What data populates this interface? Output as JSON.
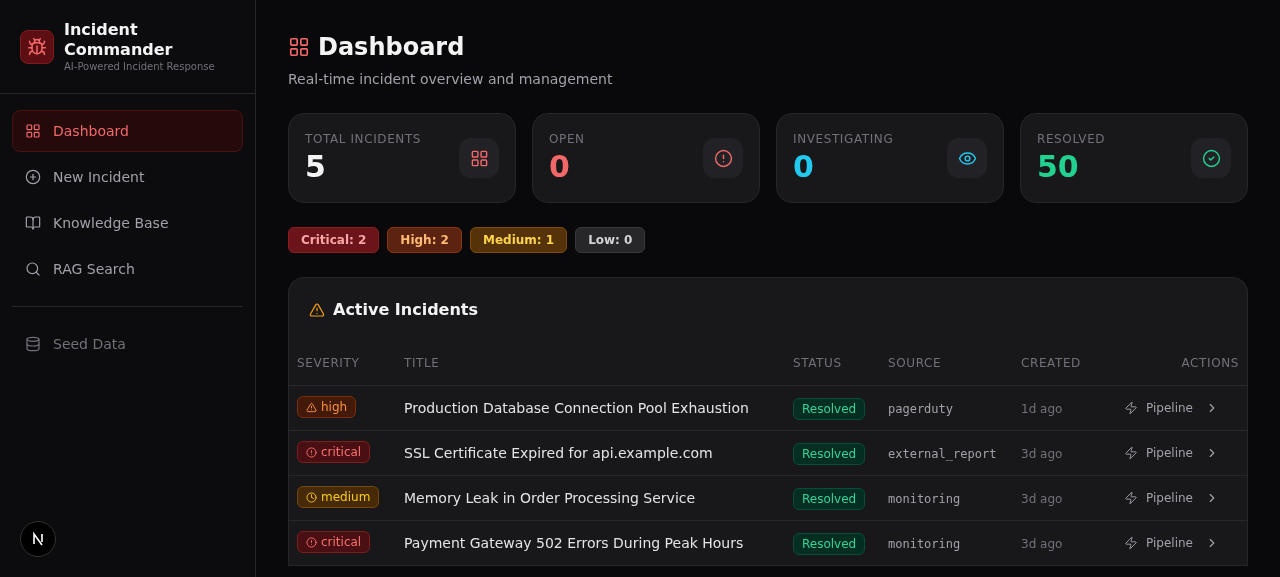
{
  "brand": {
    "title": "Incident Commander",
    "subtitle": "AI-Powered Incident Response"
  },
  "nav": [
    {
      "label": "Dashboard",
      "selected": true
    },
    {
      "label": "New Incident",
      "selected": false
    },
    {
      "label": "Knowledge Base",
      "selected": false
    },
    {
      "label": "RAG Search",
      "selected": false
    }
  ],
  "nav_secondary": [
    {
      "label": "Seed Data",
      "selected": false
    }
  ],
  "page": {
    "title": "Dashboard",
    "subtitle": "Real-time incident overview and management"
  },
  "stats": [
    {
      "label": "TOTAL INCIDENTS",
      "value": "5",
      "kind": "total"
    },
    {
      "label": "OPEN",
      "value": "0",
      "kind": "open"
    },
    {
      "label": "INVESTIGATING",
      "value": "0",
      "kind": "investigating"
    },
    {
      "label": "RESOLVED",
      "value": "50",
      "kind": "resolved"
    }
  ],
  "severity_counts": [
    {
      "label": "Critical: 2",
      "kind": "critical"
    },
    {
      "label": "High: 2",
      "kind": "high"
    },
    {
      "label": "Medium: 1",
      "kind": "medium"
    },
    {
      "label": "Low: 0",
      "kind": "low"
    }
  ],
  "incidents": {
    "title": "Active Incidents",
    "columns": [
      "SEVERITY",
      "TITLE",
      "STATUS",
      "SOURCE",
      "CREATED",
      "ACTIONS"
    ],
    "rows": [
      {
        "severity": "high",
        "title": "Production Database Connection Pool Exhaustion",
        "status": "Resolved",
        "source": "pagerduty",
        "created": "1d ago",
        "action": "Pipeline"
      },
      {
        "severity": "critical",
        "title": "SSL Certificate Expired for api.example.com",
        "status": "Resolved",
        "source": "external_report",
        "created": "3d ago",
        "action": "Pipeline"
      },
      {
        "severity": "medium",
        "title": "Memory Leak in Order Processing Service",
        "status": "Resolved",
        "source": "monitoring",
        "created": "3d ago",
        "action": "Pipeline"
      },
      {
        "severity": "critical",
        "title": "Payment Gateway 502 Errors During Peak Hours",
        "status": "Resolved",
        "source": "monitoring",
        "created": "3d ago",
        "action": "Pipeline"
      }
    ]
  }
}
